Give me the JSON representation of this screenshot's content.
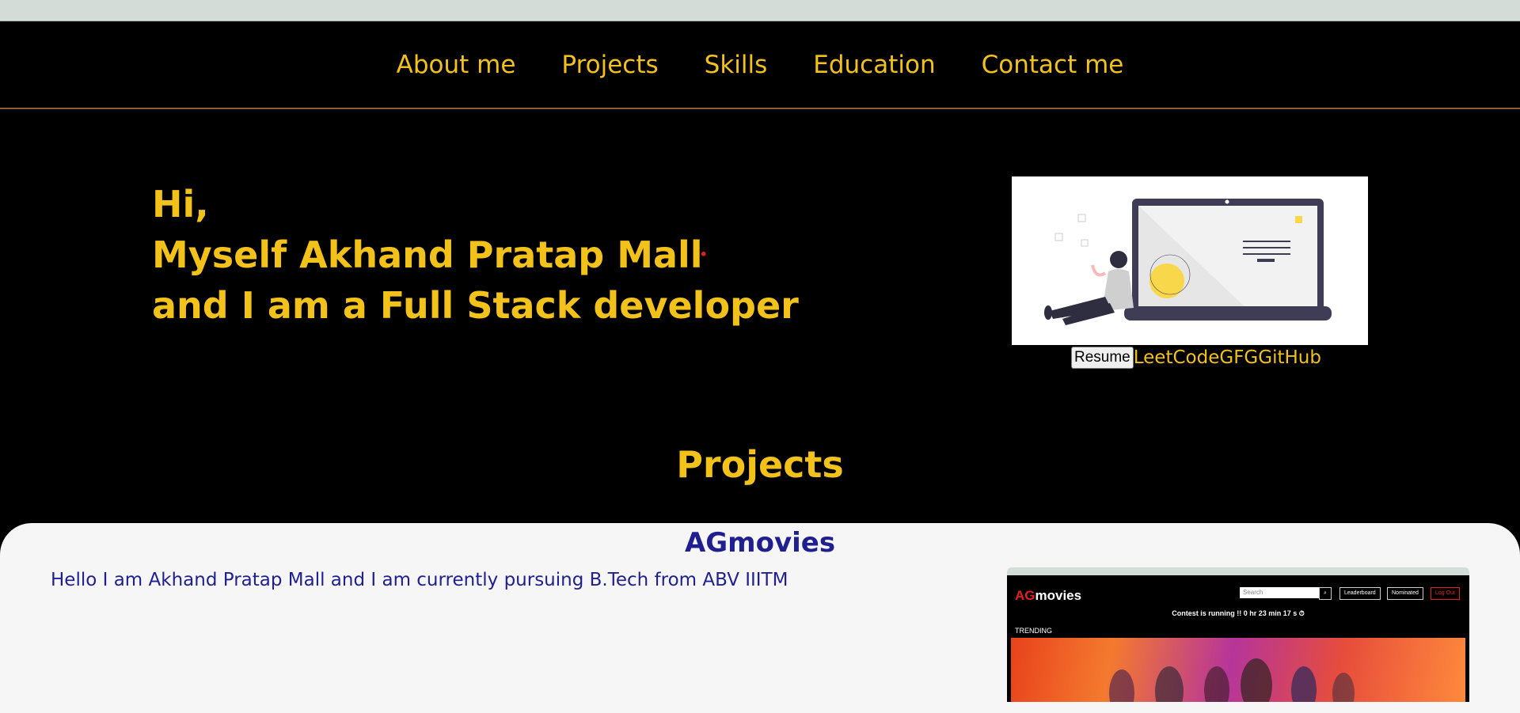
{
  "nav": {
    "items": [
      {
        "label": "About me"
      },
      {
        "label": "Projects"
      },
      {
        "label": "Skills"
      },
      {
        "label": "Education"
      },
      {
        "label": "Contact me"
      }
    ]
  },
  "hero": {
    "lines": [
      "Hi,",
      "Myself Akhand Pratap Mall",
      "and I am a Full Stack developer"
    ],
    "resume_label": "Resume",
    "links": [
      "LeetCode",
      "GFG",
      "GitHub"
    ]
  },
  "projects": {
    "title": "Projects",
    "card": {
      "name": "AGmovies",
      "description": "Hello I am Akhand Pratap Mall and I am currently pursuing B.Tech from ABV IIITM",
      "screenshot": {
        "brand_prefix": "AG",
        "brand_suffix": "movies",
        "search_placeholder": "Search",
        "buttons": [
          "Leaderboard",
          "Nominated",
          "Log Out"
        ],
        "contest": "Contest is running !! 0 hr 23 min 17 s ⏱",
        "trending": "TRENDING"
      }
    }
  },
  "colors": {
    "accent": "#f2c21b",
    "background": "#000000",
    "card_text": "#1f1f8f",
    "card_bg": "#f6f6f6"
  }
}
